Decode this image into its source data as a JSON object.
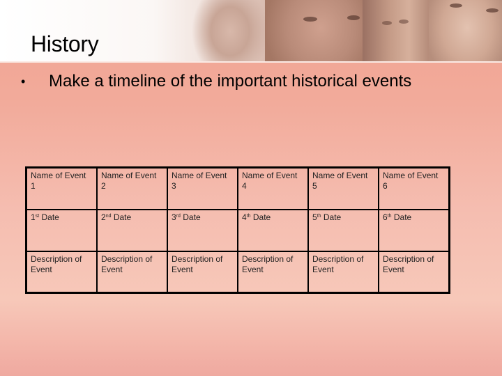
{
  "slide": {
    "title": "History",
    "bullet": "Make a timeline of the important historical events",
    "header_image": "photo-banner-faces"
  },
  "timeline": {
    "rows": {
      "names": [
        "Name of Event 1",
        "Name of Event 2",
        "Name of Event 3",
        "Name of Event 4",
        "Name of Event 5",
        "Name of Event 6"
      ],
      "dates": [
        {
          "num": "1",
          "suffix": "st",
          "label": "Date"
        },
        {
          "num": "2",
          "suffix": "nd",
          "label": "Date"
        },
        {
          "num": "3",
          "suffix": "rd",
          "label": "Date"
        },
        {
          "num": "4",
          "suffix": "th",
          "label": "Date"
        },
        {
          "num": "5",
          "suffix": "th",
          "label": "Date"
        },
        {
          "num": "6",
          "suffix": "th",
          "label": "Date"
        }
      ],
      "descriptions": [
        "Description of Event",
        "Description of Event",
        "Description of Event",
        "Description of Event",
        "Description of Event",
        "Description of Event"
      ]
    }
  },
  "colors": {
    "accent": "#f0a290",
    "border": "#000000"
  }
}
